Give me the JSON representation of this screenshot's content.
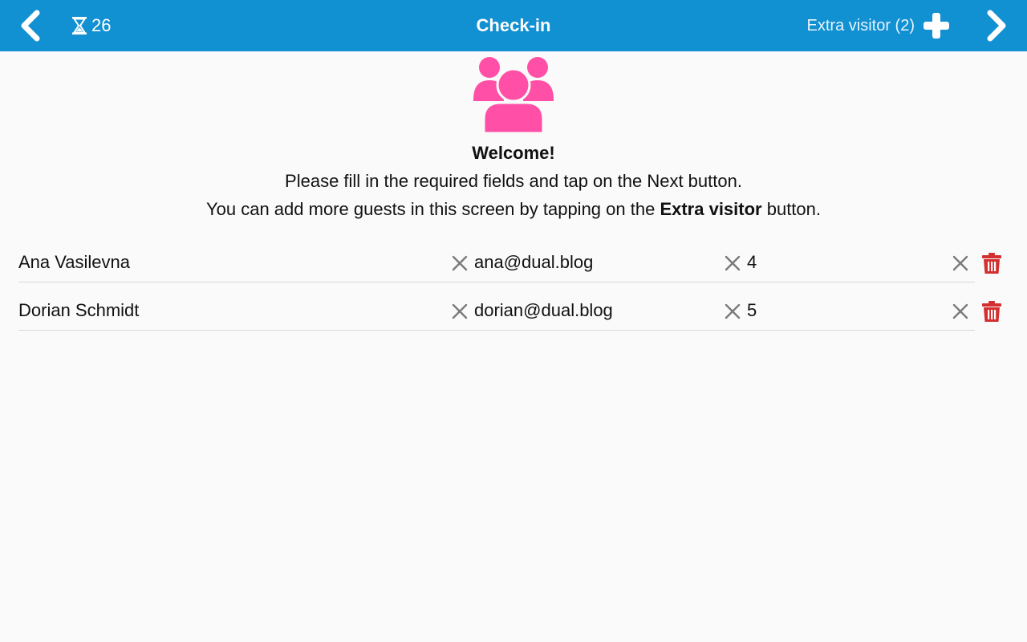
{
  "header": {
    "title": "Check-in",
    "timer_value": "26",
    "extra_visitor_label": "Extra visitor (2)",
    "bar_color": "#1190d2"
  },
  "welcome": {
    "title": "Welcome!",
    "line1": "Please fill in the required fields and tap on the Next button.",
    "line2_prefix": "You can add more guests in this screen by tapping on the ",
    "line2_bold": "Extra visitor",
    "line2_suffix": " button.",
    "icon_color": "#ff4fa6"
  },
  "visitors": [
    {
      "name": "Ana Vasilevna",
      "email": "ana@dual.blog",
      "number": "4"
    },
    {
      "name": "Dorian Schmidt",
      "email": "dorian@dual.blog",
      "number": "5"
    }
  ],
  "icons": {
    "back": "chevron-left-icon",
    "timer": "hourglass-icon",
    "add": "plus-icon",
    "next": "chevron-right-icon",
    "clear": "close-icon",
    "delete": "trash-icon",
    "welcome": "group-icon"
  },
  "colors": {
    "delete": "#d32f2f",
    "clear": "#7a7a7a"
  }
}
